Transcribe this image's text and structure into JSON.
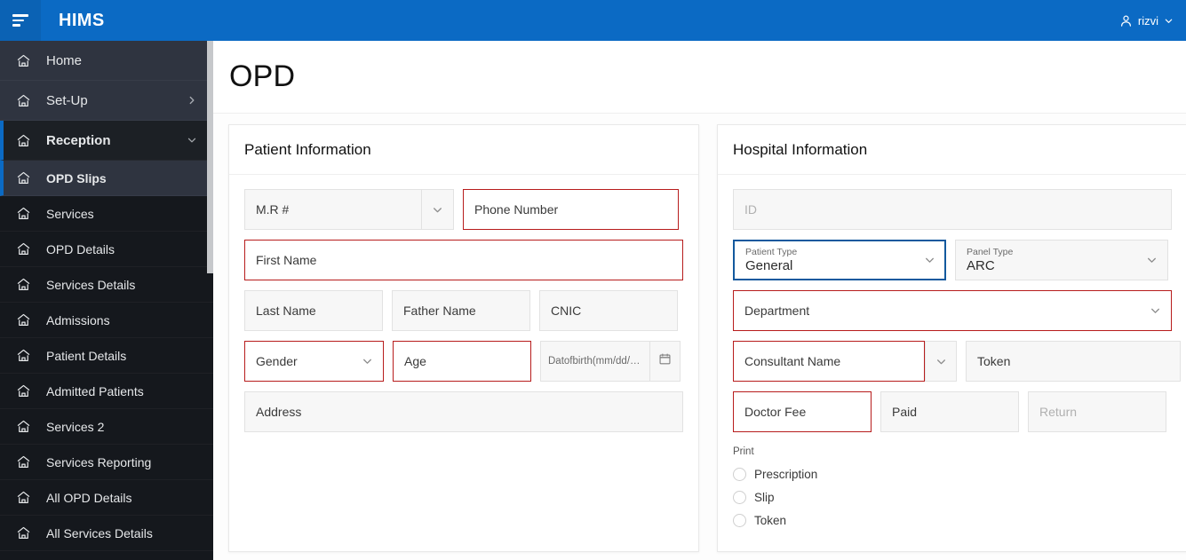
{
  "app": {
    "brand": "HIMS",
    "menu_icon": "hamburger-icon",
    "user": {
      "name": "rizvi",
      "icon": "person-icon",
      "chevron": "chevron-down-icon"
    }
  },
  "sidebar": {
    "items": [
      {
        "label": "Home",
        "level": "top",
        "state": "normal",
        "arrow": ""
      },
      {
        "label": "Set-Up",
        "level": "top",
        "state": "normal",
        "arrow": "chevron-right-icon"
      },
      {
        "label": "Reception",
        "level": "top",
        "state": "open",
        "arrow": "chevron-down-icon"
      },
      {
        "label": "OPD Slips",
        "level": "sub",
        "state": "active",
        "arrow": ""
      },
      {
        "label": "Services",
        "level": "sub",
        "state": "normal",
        "arrow": ""
      },
      {
        "label": "OPD Details",
        "level": "sub",
        "state": "normal",
        "arrow": ""
      },
      {
        "label": "Services Details",
        "level": "sub",
        "state": "normal",
        "arrow": ""
      },
      {
        "label": "Admissions",
        "level": "sub",
        "state": "normal",
        "arrow": ""
      },
      {
        "label": "Patient Details",
        "level": "sub",
        "state": "normal",
        "arrow": ""
      },
      {
        "label": "Admitted Patients",
        "level": "sub",
        "state": "normal",
        "arrow": ""
      },
      {
        "label": "Services 2",
        "level": "sub",
        "state": "normal",
        "arrow": ""
      },
      {
        "label": "Services Reporting",
        "level": "sub",
        "state": "normal",
        "arrow": ""
      },
      {
        "label": "All OPD Details",
        "level": "sub",
        "state": "normal",
        "arrow": ""
      },
      {
        "label": "All Services Details",
        "level": "sub",
        "state": "normal",
        "arrow": ""
      }
    ]
  },
  "page": {
    "title": "OPD"
  },
  "patient_panel": {
    "title": "Patient Information",
    "fields": {
      "mr_number": {
        "placeholder": "M.R #",
        "value": ""
      },
      "phone_number": {
        "placeholder": "Phone Number",
        "value": ""
      },
      "first_name": {
        "placeholder": "First Name",
        "value": ""
      },
      "last_name": {
        "placeholder": "Last Name",
        "value": ""
      },
      "father_name": {
        "placeholder": "Father Name",
        "value": ""
      },
      "cnic": {
        "placeholder": "CNIC",
        "value": ""
      },
      "gender": {
        "placeholder": "Gender",
        "value": ""
      },
      "age": {
        "placeholder": "Age",
        "value": ""
      },
      "date_of_birth": {
        "placeholder": "Datofbirth(mm/dd/yyyy)",
        "value": ""
      },
      "address": {
        "placeholder": "Address",
        "value": ""
      }
    }
  },
  "hospital_panel": {
    "title": "Hospital Information",
    "fields": {
      "id": {
        "placeholder": "ID",
        "value": ""
      },
      "patient_type": {
        "label": "Patient Type",
        "value": "General"
      },
      "panel_type": {
        "label": "Panel Type",
        "value": "ARC"
      },
      "department": {
        "placeholder": "Department",
        "value": ""
      },
      "consultant_name": {
        "placeholder": "Consultant Name",
        "value": ""
      },
      "token": {
        "placeholder": "Token",
        "value": ""
      },
      "doctor_fee": {
        "placeholder": "Doctor Fee",
        "value": ""
      },
      "paid": {
        "placeholder": "Paid",
        "value": ""
      },
      "return": {
        "placeholder": "Return",
        "value": ""
      }
    },
    "print": {
      "label": "Print",
      "options": [
        {
          "label": "Prescription",
          "selected": false
        },
        {
          "label": "Slip",
          "selected": false
        },
        {
          "label": "Token",
          "selected": false
        }
      ]
    }
  },
  "colors": {
    "brand_blue": "#0b6ac4",
    "sidebar_dark": "#15181d",
    "sidebar_slate": "#2f3440",
    "error_red": "#b71c1c",
    "focus_blue": "#13599e"
  }
}
